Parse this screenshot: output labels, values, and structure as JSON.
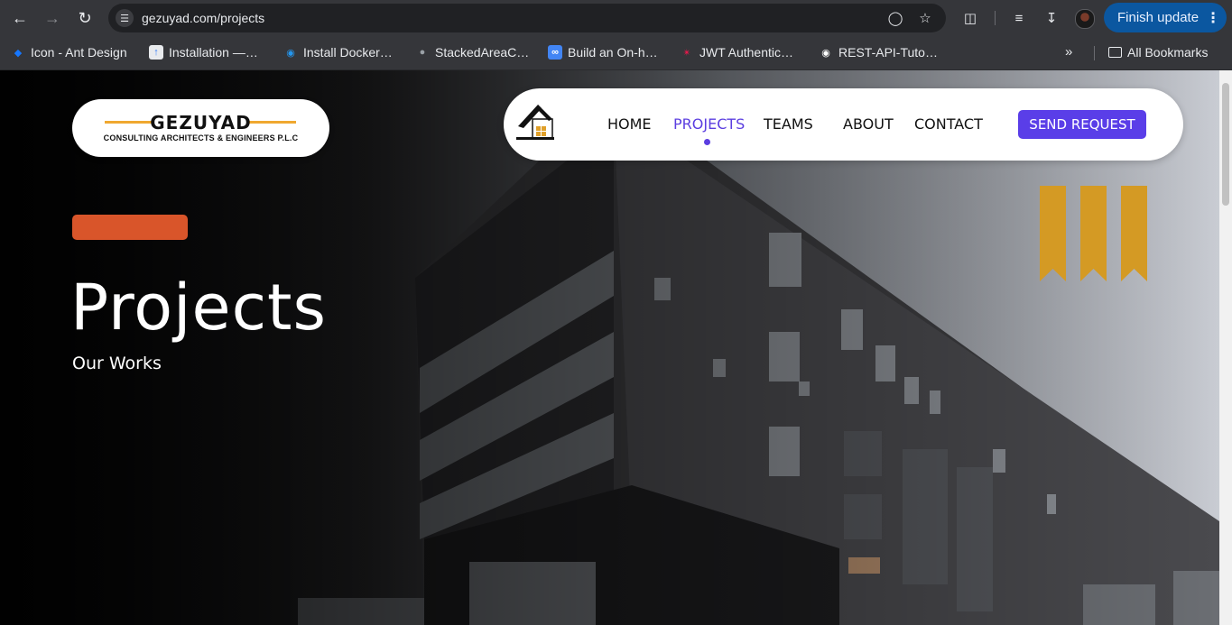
{
  "browser": {
    "url": "gezuyad.com/projects",
    "finish_update_label": "Finish update",
    "bookmarks": [
      {
        "label": "Icon - Ant Design",
        "icon": "ant-design-icon",
        "color": "#1677ff"
      },
      {
        "label": "Installation —…",
        "icon": "docs-icon",
        "color": "#3b82f6"
      },
      {
        "label": "Install Docker…",
        "icon": "docker-icon",
        "color": "#2496ed"
      },
      {
        "label": "StackedAreaC…",
        "icon": "globe-icon",
        "color": "#9aa0a6"
      },
      {
        "label": "Build an On-h…",
        "icon": "infinity-icon",
        "color": "#4285f4"
      },
      {
        "label": "JWT Authentic…",
        "icon": "jwt-icon",
        "color": "#e6194b"
      },
      {
        "label": "REST-API-Tuto…",
        "icon": "github-icon",
        "color": "#ffffff"
      }
    ],
    "all_bookmarks_label": "All Bookmarks"
  },
  "site": {
    "logo_name": "GEZUYAD",
    "logo_subtitle": "CONSULTING ARCHITECTS & ENGINEERS P.L.C",
    "nav": {
      "items": [
        "HOME",
        "PROJECTS",
        "TEAMS",
        "ABOUT",
        "CONTACT"
      ],
      "active": "PROJECTS",
      "cta": "SEND REQUEST"
    },
    "hero": {
      "title": "Projects",
      "subtitle": "Our Works"
    },
    "colors": {
      "accent": "#5a3ee8",
      "orange": "#d9552a",
      "gold": "#d49a24"
    }
  }
}
